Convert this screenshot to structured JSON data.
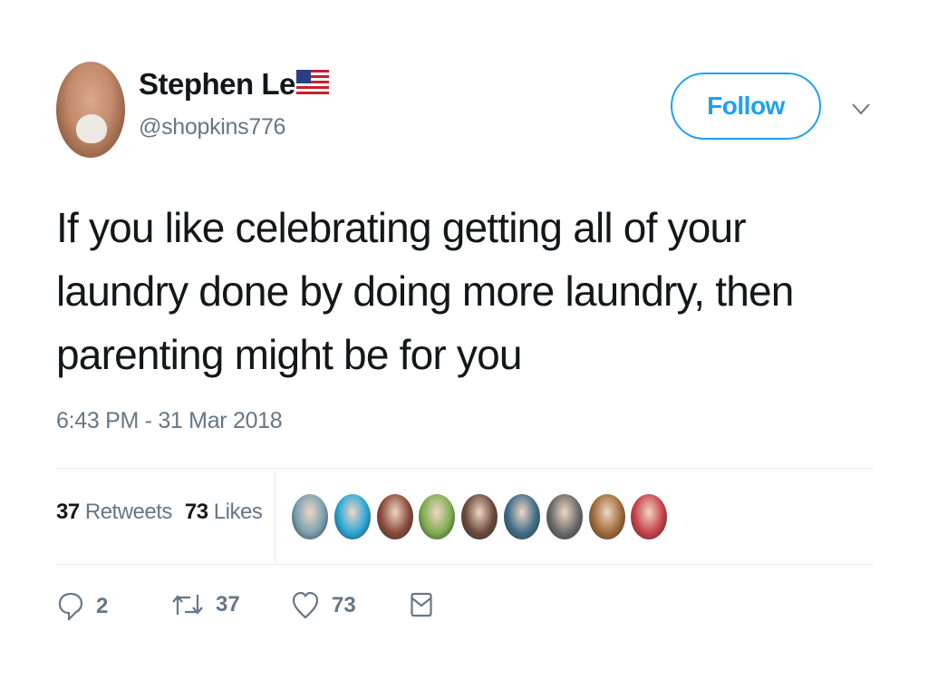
{
  "user": {
    "name": "Stephen Lee",
    "handle": "@shopkins776"
  },
  "follow_label": "Follow",
  "tweet": {
    "text": "If you like celebrating getting all of your\nlaundry done by doing more laundry, then\nparenting might be for you",
    "timestamp": "6:43 PM - 31 Mar 2018"
  },
  "stats": {
    "retweets_count": "37",
    "retweets_label": "Retweets",
    "likes_count": "73",
    "likes_label": "Likes"
  },
  "likers": [
    {
      "color": "#7aa0b0"
    },
    {
      "color": "#2aa7d8"
    },
    {
      "color": "#8a4a3a"
    },
    {
      "color": "#7fae4f"
    },
    {
      "color": "#6b4a3c"
    },
    {
      "color": "#3f6e8a"
    },
    {
      "color": "#6a6a6a"
    },
    {
      "color": "#a06a3a"
    },
    {
      "color": "#c8424a"
    }
  ],
  "actions": {
    "reply_count": "2",
    "retweet_count": "37",
    "like_count": "73"
  },
  "colors": {
    "accent": "#1da1f2",
    "secondary_text": "#657786",
    "divider": "#e6ecf0"
  }
}
